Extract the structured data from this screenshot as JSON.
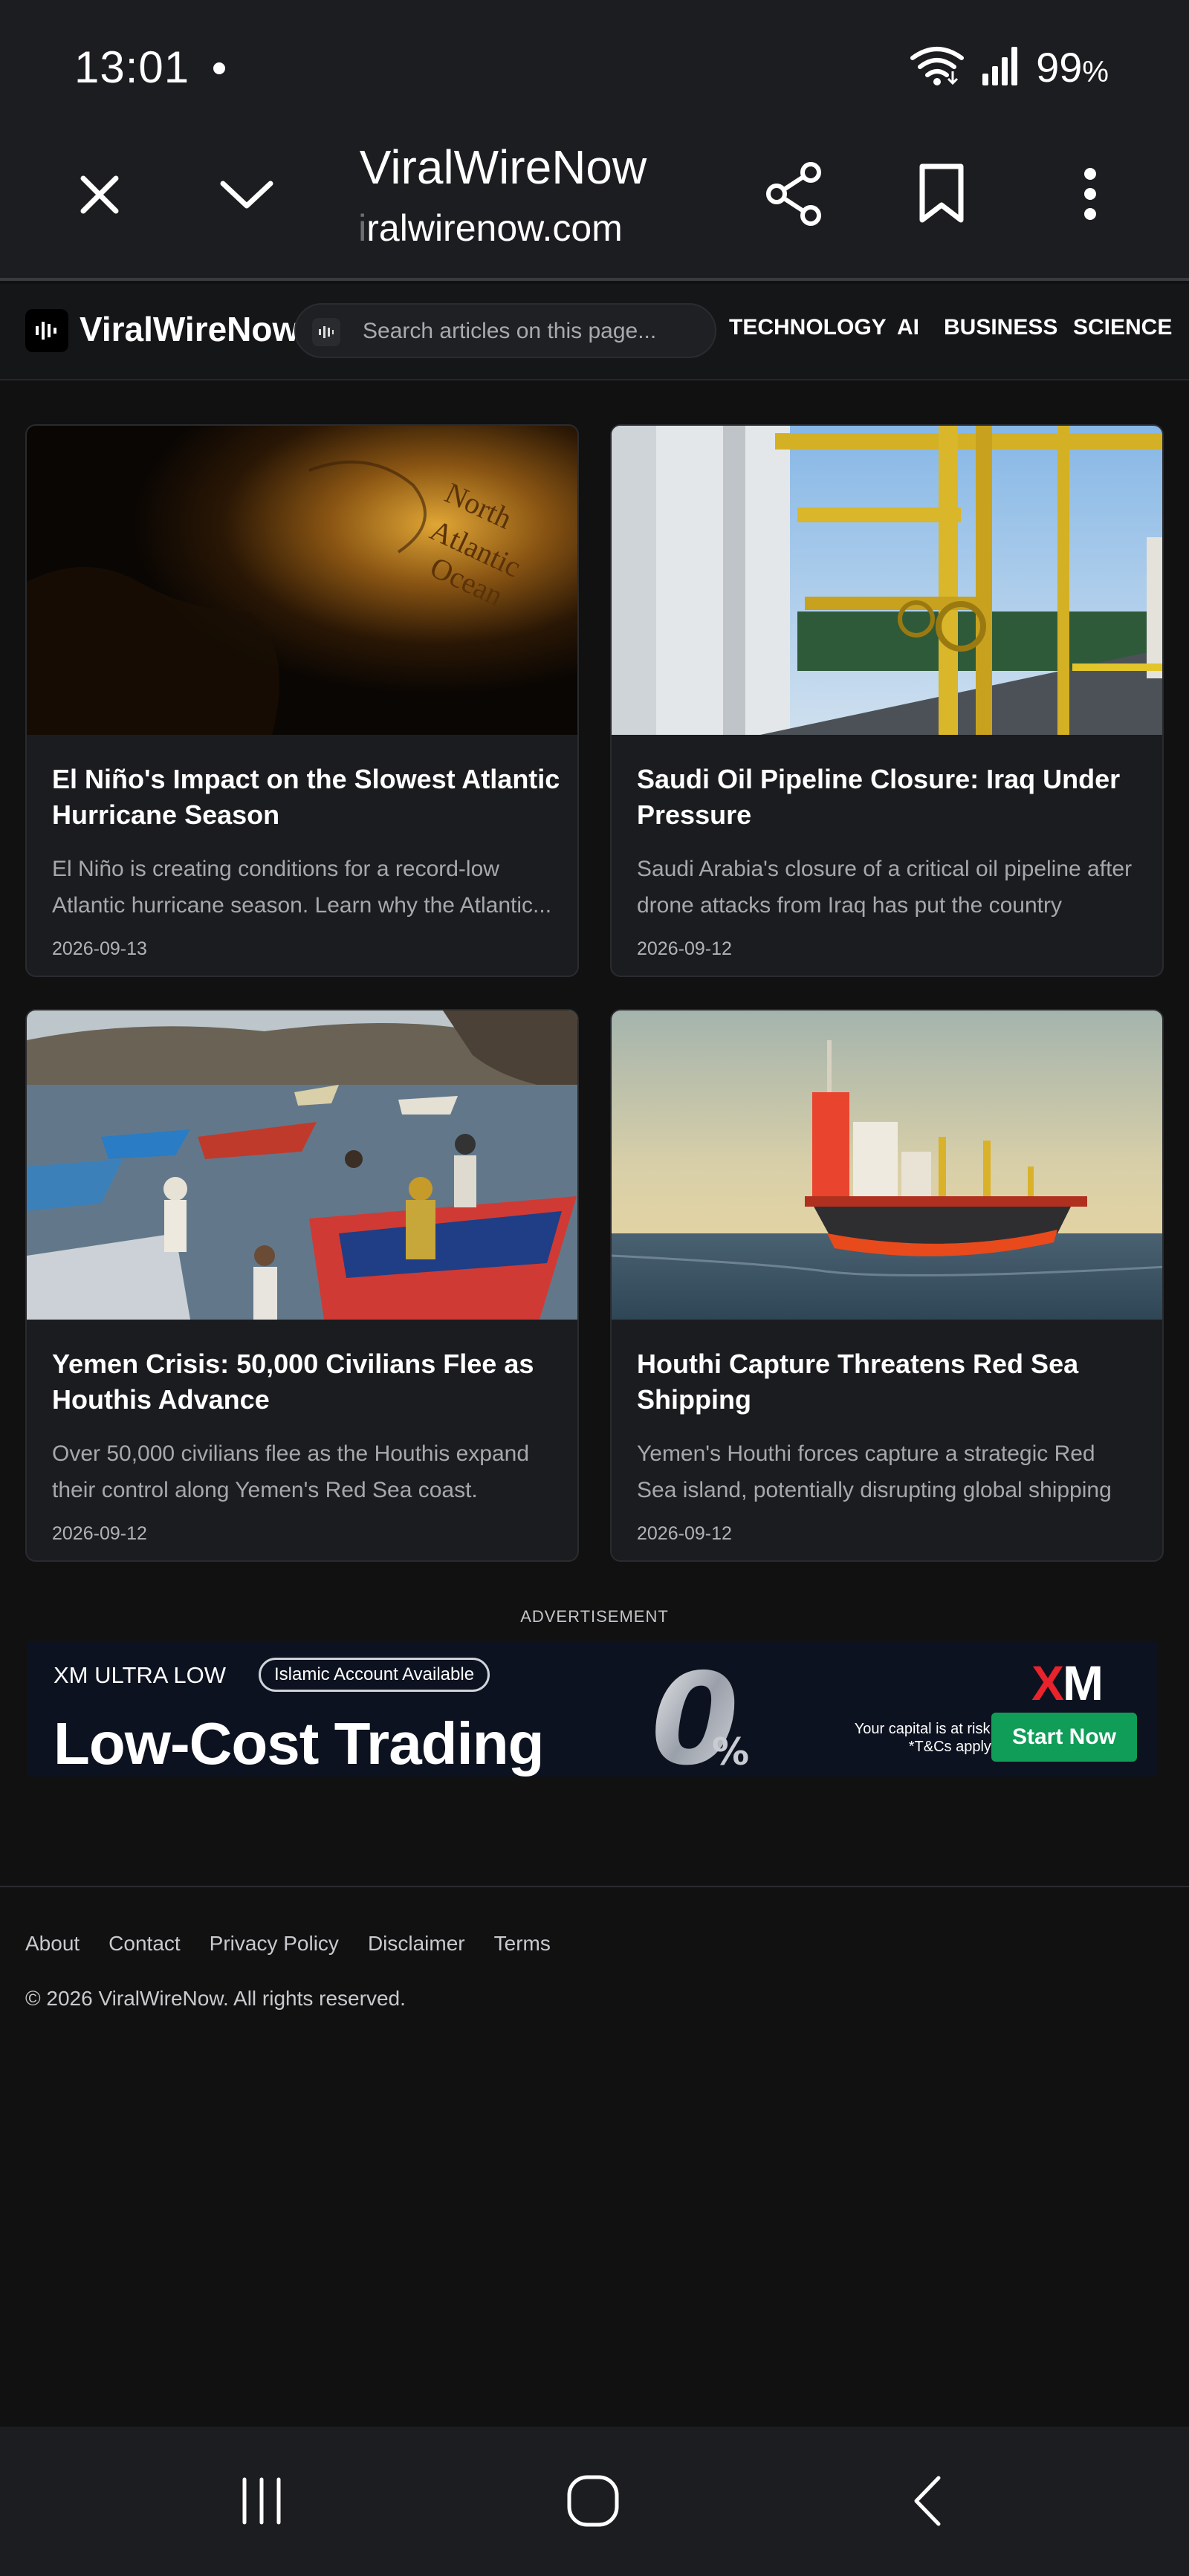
{
  "status_bar": {
    "time": "13:01",
    "battery": "99",
    "battery_unit": "%",
    "icons": [
      "wifi-icon",
      "signal-icon"
    ]
  },
  "browser": {
    "page_title": "ViralWireNow",
    "url_faded": "i",
    "url_main": "ralwirenow.com",
    "icons": [
      "close-icon",
      "chevron-down-icon",
      "share-icon",
      "bookmark-icon",
      "more-vert-icon"
    ]
  },
  "site": {
    "name": "ViralWireNow",
    "search_placeholder": "Search articles on this page...",
    "nav": [
      "TECHNOLOGY",
      "AI",
      "BUSINESS",
      "SCIENCE"
    ]
  },
  "articles": [
    {
      "title": "El Niño's Impact on the Slowest Atlantic Hurricane Season",
      "desc": "El Niño is creating conditions for a record-low Atlantic hurricane season. Learn why the Atlantic...",
      "date": "2026-09-13"
    },
    {
      "title": "Saudi Oil Pipeline Closure: Iraq Under Pressure",
      "desc": "Saudi Arabia's closure of a critical oil pipeline after drone attacks from Iraq has put the country under...",
      "date": "2026-09-12"
    },
    {
      "title": "Yemen Crisis: 50,000 Civilians Flee as Houthis Advance",
      "desc": "Over 50,000 civilians flee as the Houthis expand their control along Yemen's Red Sea coast. Learn...",
      "date": "2026-09-12"
    },
    {
      "title": "Houthi Capture Threatens Red Sea Shipping",
      "desc": "Yemen's Houthi forces capture a strategic Red Sea island, potentially disrupting global shipping routes...",
      "date": "2026-09-12"
    }
  ],
  "ad": {
    "label": "ADVERTISEMENT",
    "brand_line": "XM ULTRA LOW",
    "pill": "Islamic Account Available",
    "headline": "Low-Cost Trading",
    "zero": "0",
    "percent": "%",
    "risk_line1": "Your capital is at risk.",
    "risk_line2": "*T&Cs apply.",
    "logo_x": "X",
    "logo_m": "M",
    "cta": "Start Now",
    "accent": "#0f9d58"
  },
  "footer": {
    "links": [
      "About",
      "Contact",
      "Privacy Policy",
      "Disclaimer",
      "Terms"
    ],
    "copyright": "© 2026 ViralWireNow. All rights reserved."
  }
}
